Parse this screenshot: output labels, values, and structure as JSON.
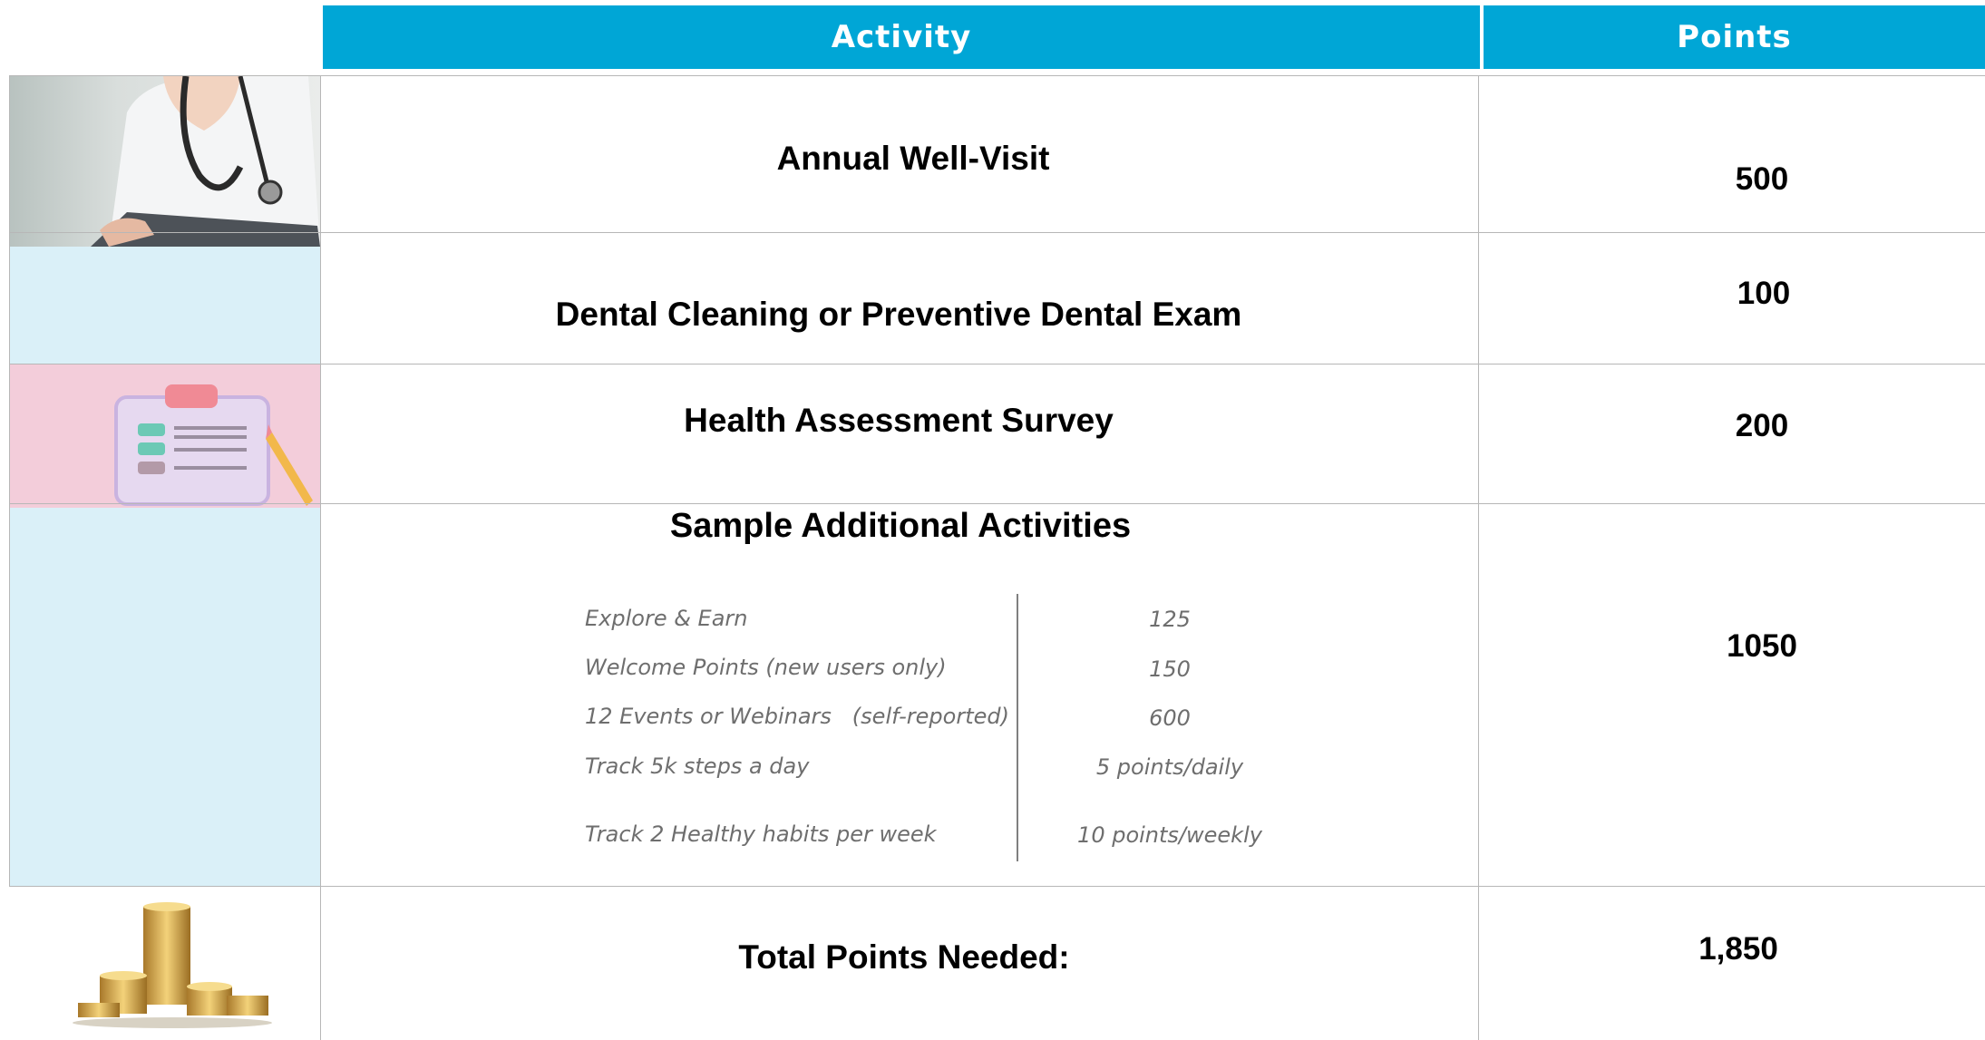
{
  "header": {
    "activity": "Activity",
    "points": "Points"
  },
  "rows": [
    {
      "activity": "Annual Well-Visit",
      "points": "500",
      "image": "doctor-photo"
    },
    {
      "activity": "Dental Cleaning or Preventive Dental Exam",
      "points": "100"
    },
    {
      "activity": "Health Assessment Survey",
      "points": "200",
      "image": "clipboard-icon"
    },
    {
      "activity": "Sample Additional Activities",
      "points": "1050"
    },
    {
      "activity": "Total Points Needed:",
      "points": "1,850",
      "image": "coins-icon"
    }
  ],
  "additional": [
    {
      "name": "Explore & Earn",
      "value": "125"
    },
    {
      "name": "Welcome Points (new users only)",
      "value": "150"
    },
    {
      "name": "12 Events or Webinars   (self-reported)",
      "value": "600"
    },
    {
      "name": "Track 5k steps a day",
      "value": "5 points/daily"
    },
    {
      "name": "Track 2 Healthy habits per week",
      "value": "10 points/weekly"
    }
  ],
  "colors": {
    "header": "#00a6d6",
    "light_blue": "#daf0f8",
    "pink": "#f3cdda"
  }
}
